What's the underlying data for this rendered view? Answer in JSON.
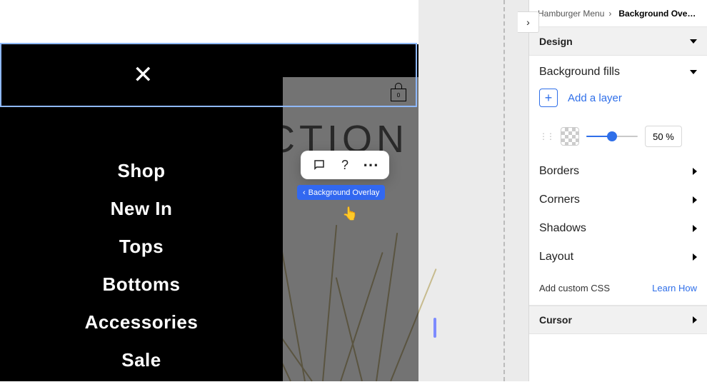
{
  "breadcrumb": {
    "parent": "Hamburger Menu",
    "sep": "›",
    "current": "Background Ove…"
  },
  "design_header": "Design",
  "fills": {
    "title": "Background fills",
    "add_label": "Add a layer",
    "opacity_value": "50 %"
  },
  "rows": {
    "borders": "Borders",
    "corners": "Corners",
    "shadows": "Shadows",
    "layout": "Layout",
    "custom_css": "Add custom CSS",
    "learn": "Learn How",
    "cursor": "Cursor"
  },
  "canvas": {
    "bg_text": "CTION",
    "menu_items": [
      "Shop",
      "New In",
      "Tops",
      "Bottoms",
      "Accessories",
      "Sale"
    ],
    "callout_label": "Background Overlay",
    "bag_count": "0"
  },
  "toolbar_icons": {
    "chat": "chat-icon",
    "help": "?",
    "more": "⋯"
  },
  "collapse_glyph": "›",
  "close_glyph": "✕",
  "callout_caret": "‹",
  "cursor_glyph": "👆"
}
